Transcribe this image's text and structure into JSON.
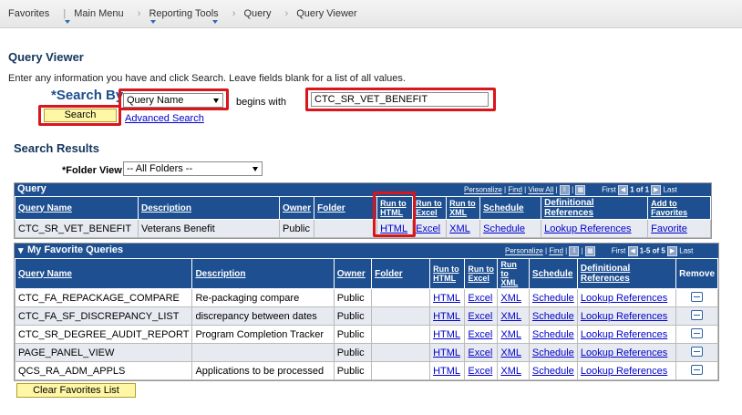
{
  "breadcrumbs": [
    "Favorites",
    "Main Menu",
    "Reporting Tools",
    "Query",
    "Query Viewer"
  ],
  "page_title": "Query Viewer",
  "instructions": "Enter any information you have and click Search. Leave fields blank for a list of all values.",
  "search": {
    "label": "*Search By",
    "by_value": "Query Name",
    "operator": "begins with",
    "input_value": "CTC_SR_VET_BENEFIT",
    "search_button": "Search",
    "advanced_link": "Advanced Search"
  },
  "results": {
    "title": "Search Results",
    "folder_label": "*Folder View",
    "folder_value": "-- All Folders --",
    "grid_title": "Query",
    "nav": {
      "personalize": "Personalize",
      "find": "Find",
      "view_all": "View All",
      "first": "First",
      "range": "1 of 1",
      "last": "Last"
    },
    "columns": [
      "Query Name",
      "Description",
      "Owner",
      "Folder",
      "Run to HTML",
      "Run to Excel",
      "Run to XML",
      "Schedule",
      "Definitional References",
      "Add to Favorites"
    ],
    "row": {
      "name": "CTC_SR_VET_BENEFIT",
      "description": "Veterans Benefit",
      "owner": "Public",
      "folder": "",
      "html": "HTML",
      "excel": "Excel",
      "xml": "XML",
      "schedule": "Schedule",
      "refs": "Lookup References",
      "fav": "Favorite"
    }
  },
  "favorites": {
    "grid_title": "My Favorite Queries",
    "nav": {
      "personalize": "Personalize",
      "find": "Find",
      "first": "First",
      "range": "1-5 of 5",
      "last": "Last"
    },
    "columns": [
      "Query Name",
      "Description",
      "Owner",
      "Folder",
      "Run to HTML",
      "Run to Excel",
      "Run to XML",
      "Schedule",
      "Definitional References",
      "Remove"
    ],
    "rows": [
      {
        "name": "CTC_FA_REPACKAGE_COMPARE",
        "description": "Re-packaging compare",
        "owner": "Public",
        "folder": "",
        "html": "HTML",
        "excel": "Excel",
        "xml": "XML",
        "schedule": "Schedule",
        "refs": "Lookup References"
      },
      {
        "name": "CTC_FA_SF_DISCREPANCY_LIST",
        "description": "discrepancy between dates",
        "owner": "Public",
        "folder": "",
        "html": "HTML",
        "excel": "Excel",
        "xml": "XML",
        "schedule": "Schedule",
        "refs": "Lookup References"
      },
      {
        "name": "CTC_SR_DEGREE_AUDIT_REPORT",
        "description": "Program Completion Tracker",
        "owner": "Public",
        "folder": "",
        "html": "HTML",
        "excel": "Excel",
        "xml": "XML",
        "schedule": "Schedule",
        "refs": "Lookup References"
      },
      {
        "name": "PAGE_PANEL_VIEW",
        "description": "",
        "owner": "Public",
        "folder": "",
        "html": "HTML",
        "excel": "Excel",
        "xml": "XML",
        "schedule": "Schedule",
        "refs": "Lookup References"
      },
      {
        "name": "QCS_RA_ADM_APPLS",
        "description": "Applications to be processed",
        "owner": "Public",
        "folder": "",
        "html": "HTML",
        "excel": "Excel",
        "xml": "XML",
        "schedule": "Schedule",
        "refs": "Lookup References"
      }
    ],
    "clear_button": "Clear Favorites List"
  },
  "colors": {
    "header_blue": "#1d4f91",
    "highlight_red": "#d8161b",
    "button_yellow": "#fff7a6",
    "link_blue": "#0000cc"
  }
}
